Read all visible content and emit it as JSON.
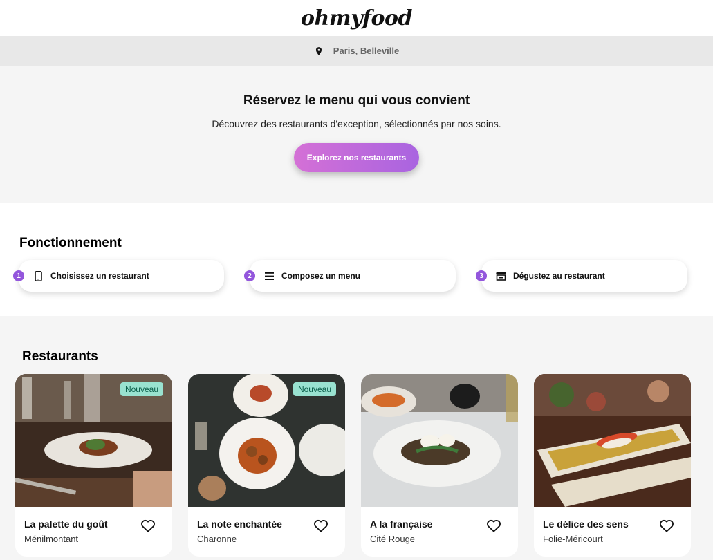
{
  "header": {
    "logo": "ohmyfood"
  },
  "location": {
    "icon": "map-pin-icon",
    "label": "Paris, Belleville"
  },
  "hero": {
    "title": "Réservez le menu qui vous convient",
    "subtitle": "Découvrez des restaurants d'exception, sélectionnés par nos soins.",
    "cta_label": "Explorez nos restaurants"
  },
  "how": {
    "title": "Fonctionnement",
    "steps": [
      {
        "number": "1",
        "icon": "mobile-phone-icon",
        "label": "Choisissez un restaurant"
      },
      {
        "number": "2",
        "icon": "list-icon",
        "label": "Composez un menu"
      },
      {
        "number": "3",
        "icon": "store-icon",
        "label": "Dégustez au restaurant"
      }
    ]
  },
  "restaurants": {
    "title": "Restaurants",
    "items": [
      {
        "name": "La palette du goût",
        "area": "Ménilmontant",
        "badge": "Nouveau"
      },
      {
        "name": "La note enchantée",
        "area": "Charonne",
        "badge": "Nouveau"
      },
      {
        "name": "A la française",
        "area": "Cité Rouge"
      },
      {
        "name": "Le délice des sens",
        "area": "Folie-Méricourt"
      }
    ]
  },
  "colors": {
    "accent_start": "#d470d6",
    "accent_end": "#a964e0",
    "step_number": "#9356dc",
    "badge_bg": "#99e2d0"
  }
}
